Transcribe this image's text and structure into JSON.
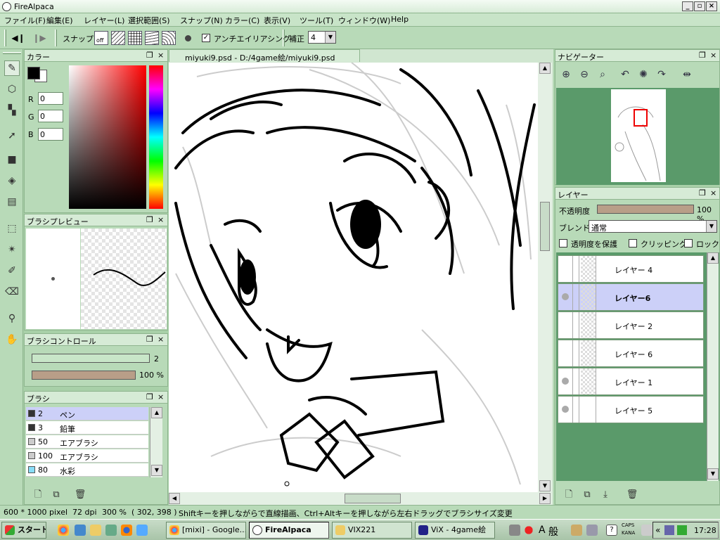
{
  "window": {
    "title": "FireAlpaca",
    "min": "_",
    "max": "▫",
    "close": "×"
  },
  "menu": [
    "ファイル(F)",
    "編集(E)",
    "レイヤー(L)",
    "選択範囲(S)",
    "スナップ(N)",
    "カラー(C)",
    "表示(V)",
    "ツール(T)",
    "ウィンドウ(W)",
    "Help"
  ],
  "toolbar": {
    "snap_label": "スナップ",
    "snap_off": "off",
    "antialias_label": "アンチエイリアシング",
    "correction_label": "補正",
    "correction_value": "4"
  },
  "color_panel": {
    "title": "カラー",
    "r_label": "R",
    "g_label": "G",
    "b_label": "B",
    "r": "0",
    "g": "0",
    "b": "0",
    "fg": "#000000",
    "bg": "#ffffff"
  },
  "brush_preview": {
    "title": "ブラシプレビュー"
  },
  "brush_control": {
    "title": "ブラシコントロール",
    "size": "2",
    "opacity": "100 %"
  },
  "brush_panel": {
    "title": "ブラシ",
    "items": [
      {
        "size": "2",
        "name": "ペン",
        "swatch": "#333333"
      },
      {
        "size": "3",
        "name": "鉛筆",
        "swatch": "#333333"
      },
      {
        "size": "50",
        "name": "エアブラシ",
        "swatch": "#cccccc"
      },
      {
        "size": "100",
        "name": "エアブラシ",
        "swatch": "#cccccc"
      },
      {
        "size": "80",
        "name": "水彩",
        "swatch": "#88ddf8"
      }
    ]
  },
  "document": {
    "tab": "miyuki9.psd - D:/4game絵/miyuki9.psd"
  },
  "navigator": {
    "title": "ナビゲーター"
  },
  "layer_panel": {
    "title": "レイヤー",
    "opacity_label": "不透明度",
    "opacity": "100 %",
    "blend_label": "ブレンド",
    "blend_value": "通常",
    "protect_label": "透明度を保護",
    "clip_label": "クリッピング",
    "lock_label": "ロック",
    "layers": [
      {
        "name": "レイヤー 4"
      },
      {
        "name": "レイヤー6"
      },
      {
        "name": "レイヤー 2"
      },
      {
        "name": "レイヤー 6"
      },
      {
        "name": "レイヤー 1"
      },
      {
        "name": "レイヤー 5"
      }
    ]
  },
  "status": {
    "size": "600 * 1000 pixel",
    "dpi": "72 dpi",
    "zoom": "300 %",
    "coords": "( 302, 398 )",
    "hint": "Shiftキーを押しながらで直線描画、Ctrl+Altキーを押しながら左右ドラッグでブラシサイズ変更"
  },
  "taskbar": {
    "start": "スタート",
    "tasks": [
      "[mixi] - Google...",
      "FireAlpaca",
      "VIX221",
      "ViX - 4game絵"
    ],
    "ime_a": "A",
    "ime_kan": "般",
    "caps": "CAPS",
    "kana": "KANA",
    "clock": "17:28"
  }
}
